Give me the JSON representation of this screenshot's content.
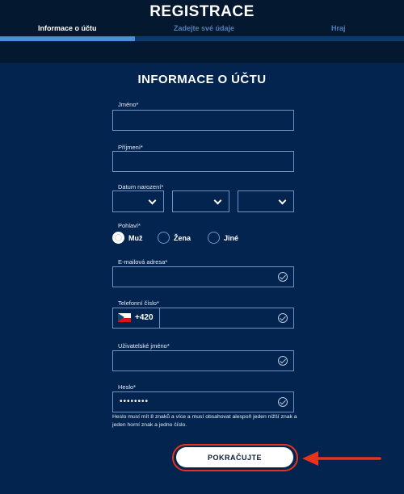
{
  "header": {
    "title": "REGISTRACE",
    "steps": [
      {
        "label": "Informace o účtu"
      },
      {
        "label": "Zadejte své údaje"
      },
      {
        "label": "Hraj"
      }
    ],
    "progress_fraction": 0.333
  },
  "form": {
    "section_title": "INFORMACE O ÚČTU",
    "first_name": {
      "label": "Jméno*",
      "value": ""
    },
    "last_name": {
      "label": "Příjmení*",
      "value": ""
    },
    "birth_date": {
      "label": "Datum narození*",
      "day": "",
      "month": "",
      "year": ""
    },
    "gender": {
      "label": "Pohlaví*",
      "options": [
        "Muž",
        "Žena",
        "Jiné"
      ],
      "selected": "Muž"
    },
    "email": {
      "label": "E-mailová adresa*",
      "value": "",
      "valid": true
    },
    "phone": {
      "label": "Telefonní číslo*",
      "dial_code": "+420",
      "flag": "czech-flag-icon",
      "value": "",
      "valid": true
    },
    "username": {
      "label": "Uživatelské jméno*",
      "value": "",
      "valid": true
    },
    "password": {
      "label": "Heslo*",
      "value": "••••••••",
      "valid": true,
      "hint": "Heslo musí mít 8 znaků a více a musí obsahovat alespoň jeden nižší znak a jeden horní znak a jedno číslo."
    },
    "submit_label": "POKRAČUJTE"
  },
  "icons": {
    "field_valid": "check-circle-icon",
    "select": "chevron-down-icon",
    "annotation": "red-arrow-icon"
  },
  "colors": {
    "background": "#02244f",
    "topbar": "#04182f",
    "progress": "#4b8fd6",
    "highlight": "#e8331c"
  }
}
